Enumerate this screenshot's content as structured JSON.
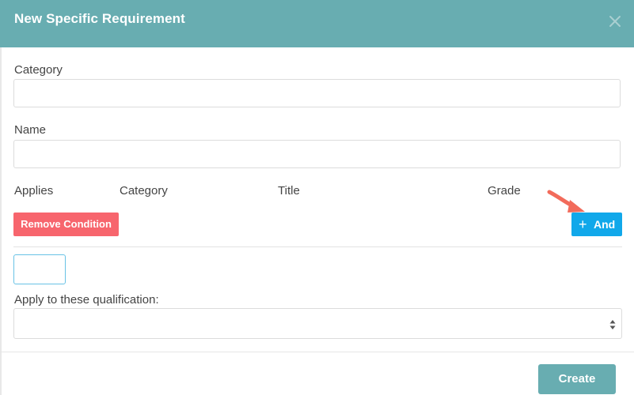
{
  "modal": {
    "title": "New Specific Requirement",
    "close_icon": "close-icon"
  },
  "form": {
    "category_label": "Category",
    "category_value": "",
    "name_label": "Name",
    "name_value": "",
    "columns": [
      "Applies",
      "Category",
      "Title",
      "Grade"
    ],
    "remove_condition_label": "Remove Condition",
    "and_button": {
      "icon": "plus-icon",
      "label": "And"
    },
    "apply_label": "Apply to these qualification:",
    "apply_selected": ""
  },
  "footer": {
    "create_label": "Create"
  },
  "colors": {
    "header": "#68adb1",
    "remove": "#f7656d",
    "and": "#11a8ea",
    "annotation_arrow": "#f26b5b"
  }
}
